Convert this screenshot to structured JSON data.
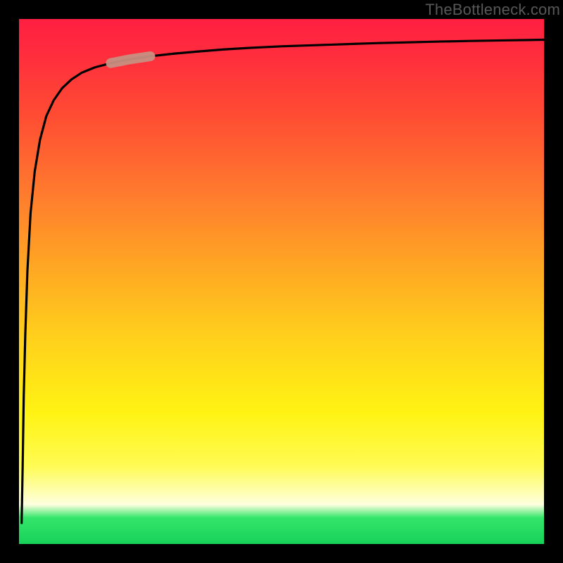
{
  "attribution": "TheBottleneck.com",
  "colors": {
    "frame": "#000000",
    "gradient_top": "#ff1f42",
    "gradient_mid": "#fff313",
    "gradient_low_white": "#fdffdf",
    "gradient_bottom": "#17d159",
    "curve": "#000000",
    "highlight_stroke": "#c78f82"
  },
  "chart_data": {
    "type": "line",
    "title": "",
    "xlabel": "",
    "ylabel": "",
    "xlim": [
      0,
      100
    ],
    "ylim": [
      0,
      100
    ],
    "grid": false,
    "legend": false,
    "series": [
      {
        "name": "curve",
        "x": [
          0.5,
          0.7,
          0.9,
          1.2,
          1.6,
          2.2,
          3.0,
          4.0,
          5.2,
          6.6,
          8.2,
          10.0,
          12.0,
          14.5,
          17.5,
          21.0,
          25.0,
          29.5,
          34.0,
          39.0,
          44.0,
          50.0,
          56.0,
          62.0,
          68.0,
          74.0,
          80.0,
          86.0,
          92.0,
          97.0,
          100.0
        ],
        "values": [
          4.0,
          15.0,
          28.0,
          40.0,
          52.0,
          63.0,
          71.0,
          77.0,
          81.5,
          84.5,
          86.8,
          88.5,
          89.8,
          90.8,
          91.6,
          92.3,
          92.9,
          93.4,
          93.8,
          94.2,
          94.5,
          94.8,
          95.0,
          95.2,
          95.4,
          95.55,
          95.7,
          95.82,
          95.92,
          96.0,
          96.05
        ]
      }
    ],
    "highlight_segment": {
      "x_start": 17.5,
      "x_end": 25.0
    }
  }
}
